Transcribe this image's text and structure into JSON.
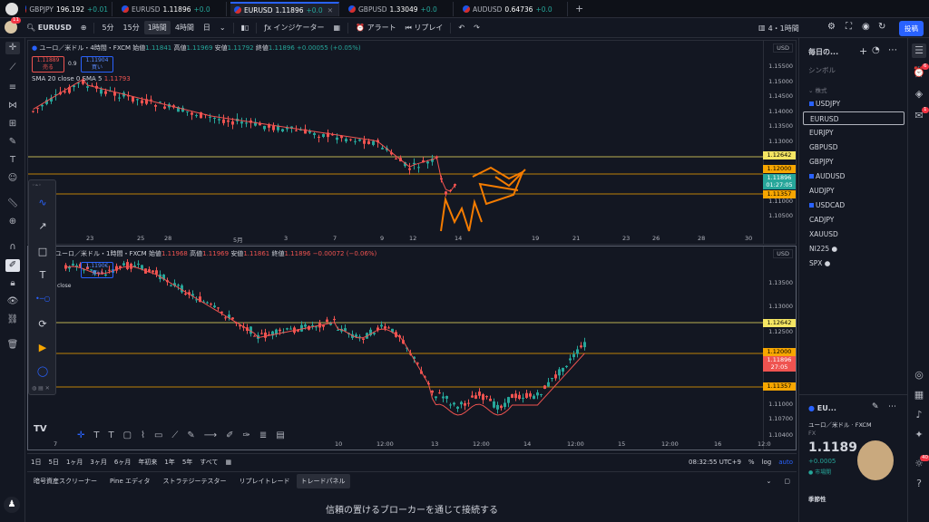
{
  "tabs": [
    {
      "symbol": "GBPJPY",
      "price": "196.192",
      "chg": "+0.01"
    },
    {
      "symbol": "EURUSD",
      "price": "1.11896",
      "chg": "+0.0"
    },
    {
      "symbol": "EURUSD",
      "price": "1.11896",
      "chg": "+0.0"
    },
    {
      "symbol": "GBPUSD",
      "price": "1.33049",
      "chg": "+0.0"
    },
    {
      "symbol": "AUDUSD",
      "price": "0.64736",
      "chg": "+0.0"
    }
  ],
  "toolbar": {
    "badge": "11",
    "symbol": "EURUSD",
    "intervals": [
      "5分",
      "15分",
      "1時間",
      "4時間",
      "日"
    ],
    "indicators": "インジケーター",
    "alert": "アラート",
    "replay": "リプレイ",
    "layout": "4・1時間",
    "post": "投稿"
  },
  "pane1": {
    "title": "ユーロ／米ドル・4時間・FXCM",
    "o_lab": "始値",
    "o": "1.11841",
    "h_lab": "高値",
    "h": "1.11969",
    "l_lab": "安値",
    "l": "1.11792",
    "c_lab": "終値",
    "c": "1.11896",
    "chg": "+0.00055 (+0.05%)",
    "sell": "1.11889",
    "sell_lab": "売る",
    "lot": "0.9",
    "buy": "1.11904",
    "buy_lab": "買い",
    "sma": "SMA 20 close 0 SMA 5",
    "sma_val": "1.11793",
    "currency": "USD",
    "y_labels": [
      "1.15500",
      "1.15000",
      "1.14500",
      "1.14000",
      "1.13500",
      "1.13000",
      "1.12500",
      "1.12000",
      "1.11500",
      "1.11000",
      "1.10500"
    ],
    "tags": {
      "a": "1.12642",
      "b": "1.12000",
      "cur": "1.11896",
      "timer": "01:27:05",
      "c": "1.11357"
    },
    "x_labels": [
      "23",
      "25",
      "28",
      "5月",
      "3",
      "7",
      "9",
      "12",
      "14",
      "19",
      "21",
      "23",
      "26",
      "28",
      "30"
    ]
  },
  "pane2": {
    "title": "ユーロ／米ドル・1時間・FXCM",
    "o_lab": "始値",
    "o": "1.11968",
    "h_lab": "高値",
    "h": "1.11969",
    "l_lab": "安値",
    "l": "1.11861",
    "c_lab": "終値",
    "c": "1.11896",
    "chg": "−0.00072 (−0.06%)",
    "buy": "1.1190€",
    "buy_lab": "買い",
    "sma": "close",
    "currency": "USD",
    "y_labels": [
      "1.13500",
      "1.13000",
      "1.12500",
      "1.12000",
      "1.11500",
      "1.11000",
      "1.10700",
      "1.10400"
    ],
    "tags": {
      "a": "1.12642",
      "b": "1.12000",
      "cur": "1.11896",
      "timer": "27:05",
      "c": "1.11357"
    },
    "x_labels": [
      "7",
      "10",
      "12:00",
      "13",
      "12:00",
      "14",
      "12:00",
      "15",
      "12:00",
      "16",
      "12:0"
    ]
  },
  "timerange": {
    "ranges": [
      "1日",
      "5日",
      "1ヶ月",
      "3ヶ月",
      "6ヶ月",
      "年初来",
      "1年",
      "5年",
      "すべて"
    ],
    "clock": "08:32:55 UTC+9"
  },
  "bottom_tabs": [
    "暗号資産スクリーナー",
    "Pine エディタ",
    "ストラテジーテスター",
    "リプレイトレード",
    "トレードパネル"
  ],
  "broker": "信頼の置けるブローカーを通じて接続する",
  "watchlist": {
    "title": "毎日の...",
    "col": "シンボル",
    "section": "株式",
    "items": [
      "USDJPY",
      "EURUSD",
      "EURJPY",
      "GBPUSD",
      "GBPJPY",
      "AUDUSD",
      "AUDJPY",
      "USDCAD",
      "CADJPY",
      "XAUUSD",
      "NI225 ●",
      "SPX ●"
    ]
  },
  "detail": {
    "sym": "EU...",
    "name": "ユーロ／米ドル",
    "src": "FXCM",
    "type": "FX",
    "price": "1.1189",
    "chg": "+0.0005",
    "status": "市場開",
    "seasonal": "季節性"
  },
  "side_badges": {
    "a": "6",
    "b": "1",
    "c": "40"
  }
}
